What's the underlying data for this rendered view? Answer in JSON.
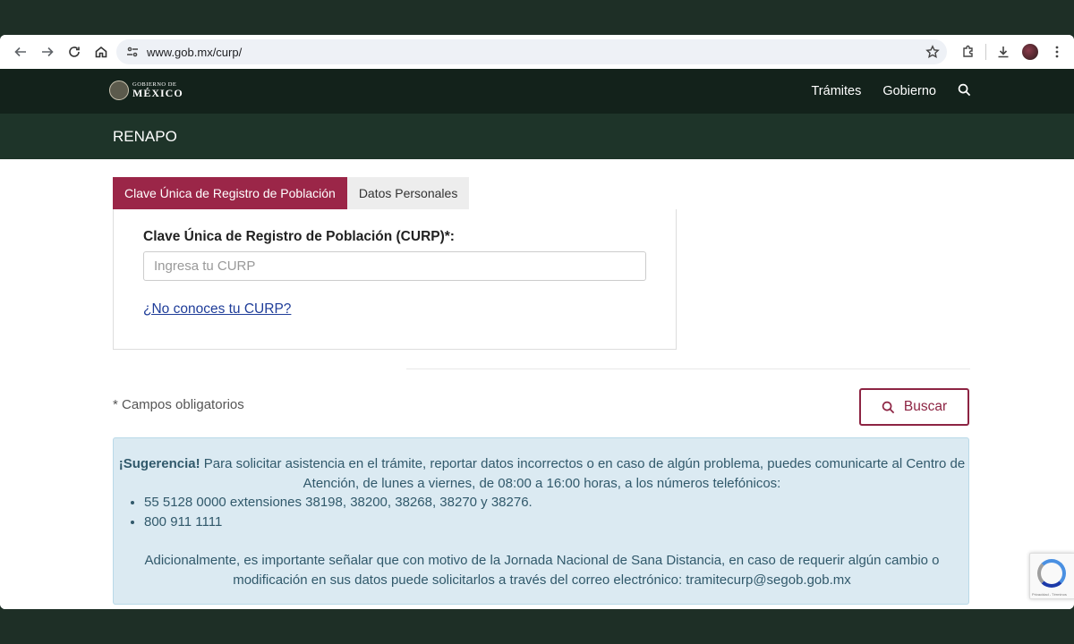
{
  "browser": {
    "url": "www.gob.mx/curp/",
    "icons": [
      "back-icon",
      "forward-icon",
      "reload-icon",
      "home-icon",
      "site-settings-icon",
      "bookmark-star-icon",
      "extensions-icon",
      "download-icon",
      "profile-avatar",
      "menu-dots-icon"
    ]
  },
  "gov_header": {
    "logo_line1": "GOBIERNO DE",
    "logo_line2": "MÉXICO",
    "nav": [
      "Trámites",
      "Gobierno"
    ],
    "search_icon": "search-icon"
  },
  "sub_header": {
    "title": "RENAPO"
  },
  "tabs": [
    {
      "label": "Clave Única de Registro de Población",
      "active": true
    },
    {
      "label": "Datos Personales",
      "active": false
    }
  ],
  "form": {
    "curp_label": "Clave Única de Registro de Población (CURP)*:",
    "curp_placeholder": "Ingresa tu CURP",
    "curp_value": "",
    "help_link": "¿No conoces tu CURP?"
  },
  "required_note": "* Campos obligatorios",
  "search_button": {
    "label": "Buscar",
    "icon": "search-icon"
  },
  "alert": {
    "title": "¡Sugerencia!",
    "text1": " Para solicitar asistencia en el trámite, reportar datos incorrectos o en caso de algún problema, puedes comunicarte al Centro de Atención, de lunes a viernes, de 08:00 a 16:00 horas, a los números telefónicos:",
    "phones": [
      "55 5128 0000 extensiones 38198, 38200, 38268, 38270 y 38276.",
      "800 911 1111"
    ],
    "text2": "Adicionalmente, es importante señalar que con motivo de la Jornada Nacional de Sana Distancia, en caso de requerir algún cambio o modificación en sus datos puede solicitarlos a través del correo electrónico: tramitecurp@segob.gob.mx"
  },
  "recaptcha": {
    "footer": "Privacidad - Términos"
  },
  "colors": {
    "page_bg": "#1e2f26",
    "gov_header": "#13221b",
    "sub_header": "#1e3429",
    "accent": "#9b2648",
    "alert_bg": "#dbeaf2"
  }
}
